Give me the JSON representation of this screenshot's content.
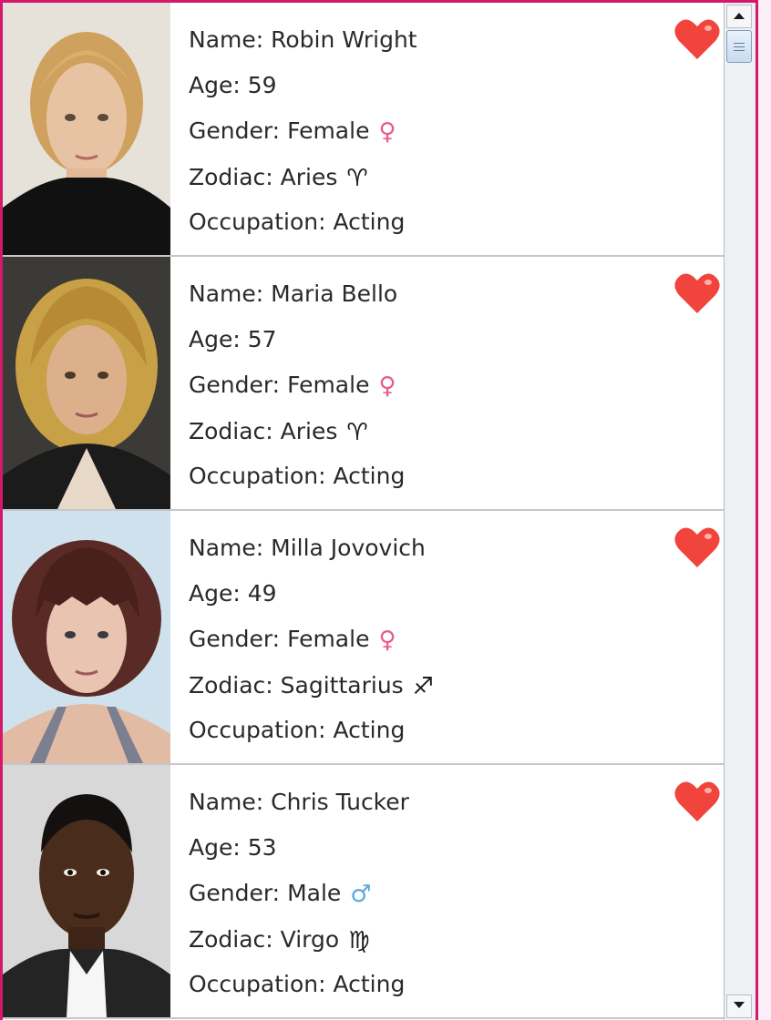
{
  "labels": {
    "name": "Name: ",
    "age": "Age: ",
    "gender": "Gender: ",
    "zodiac": "Zodiac: ",
    "occupation": "Occupation: "
  },
  "people": [
    {
      "name": "Robin Wright",
      "age": "59",
      "gender": "Female",
      "gender_symbol": "♀",
      "zodiac": "Aries",
      "zodiac_symbol": "♈",
      "occupation": "Acting",
      "favorite": true
    },
    {
      "name": "Maria Bello",
      "age": "57",
      "gender": "Female",
      "gender_symbol": "♀",
      "zodiac": "Aries",
      "zodiac_symbol": "♈",
      "occupation": "Acting",
      "favorite": true
    },
    {
      "name": "Milla Jovovich",
      "age": "49",
      "gender": "Female",
      "gender_symbol": "♀",
      "zodiac": "Sagittarius",
      "zodiac_symbol": "♐",
      "occupation": "Acting",
      "favorite": true
    },
    {
      "name": "Chris Tucker",
      "age": "53",
      "gender": "Male",
      "gender_symbol": "♂",
      "zodiac": "Virgo",
      "zodiac_symbol": "♍",
      "occupation": "Acting",
      "favorite": true
    }
  ],
  "icons": {
    "favorite": "heart-icon",
    "female": "female-symbol-icon",
    "male": "male-symbol-icon"
  },
  "colors": {
    "frame": "#d4186c",
    "heart": "#f0443c",
    "female": "#e85d88",
    "male": "#5aa8e0"
  },
  "scrollbar": {
    "position": 0.0
  }
}
